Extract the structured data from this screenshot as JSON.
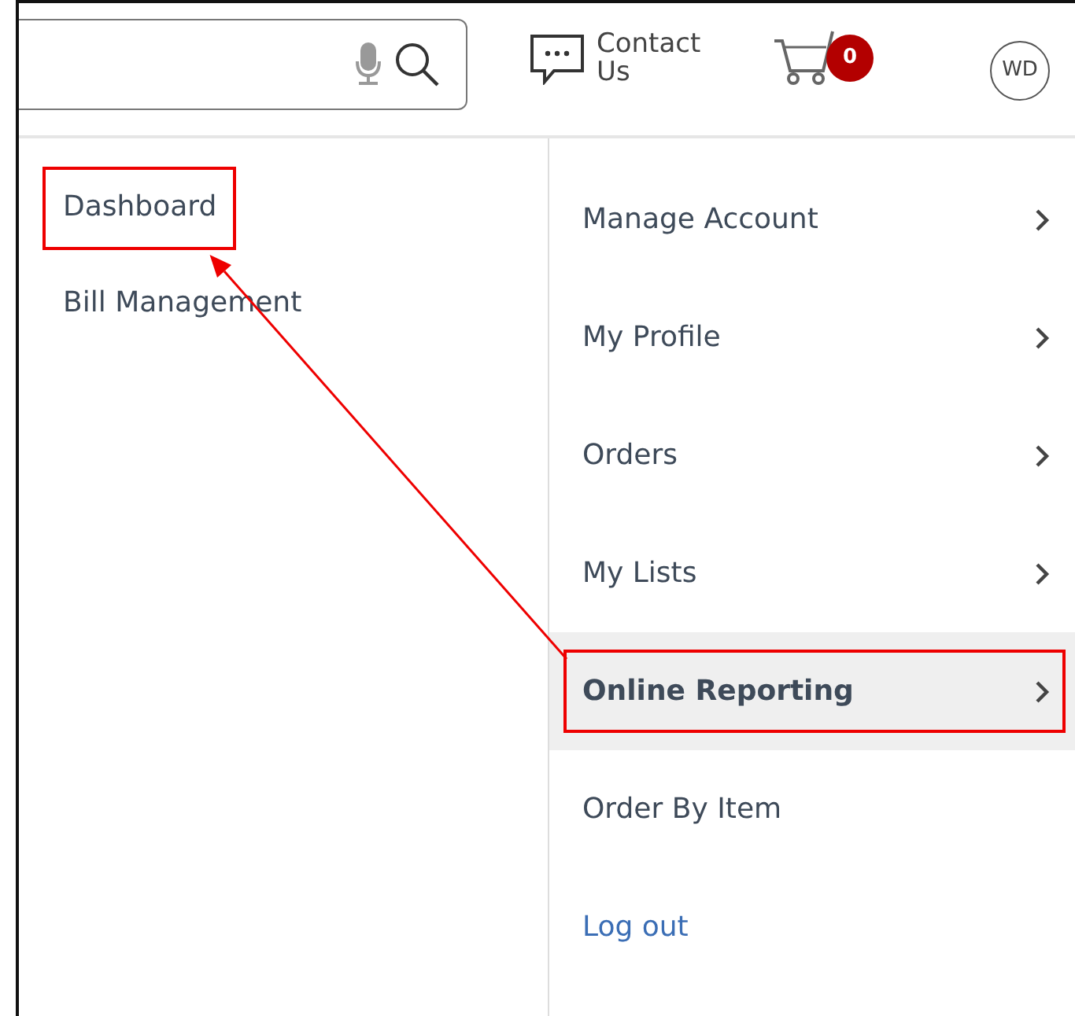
{
  "header": {
    "contact_label": "Contact Us",
    "cart_count": "0",
    "avatar_initials": "WD"
  },
  "side_links": [
    {
      "label": "Dashboard",
      "annotated": true
    },
    {
      "label": "Bill Management",
      "annotated": false
    }
  ],
  "account_menu": [
    {
      "label": "Manage Account",
      "kind": "submenu",
      "selected": false,
      "annotated": false
    },
    {
      "label": "My Profile",
      "kind": "submenu",
      "selected": false,
      "annotated": false
    },
    {
      "label": "Orders",
      "kind": "submenu",
      "selected": false,
      "annotated": false
    },
    {
      "label": "My Lists",
      "kind": "submenu",
      "selected": false,
      "annotated": false
    },
    {
      "label": "Online Reporting",
      "kind": "submenu",
      "selected": true,
      "annotated": true
    },
    {
      "label": "Order By Item",
      "kind": "plain",
      "selected": false,
      "annotated": false
    },
    {
      "label": "Log out",
      "kind": "link",
      "selected": false,
      "annotated": false
    }
  ]
}
